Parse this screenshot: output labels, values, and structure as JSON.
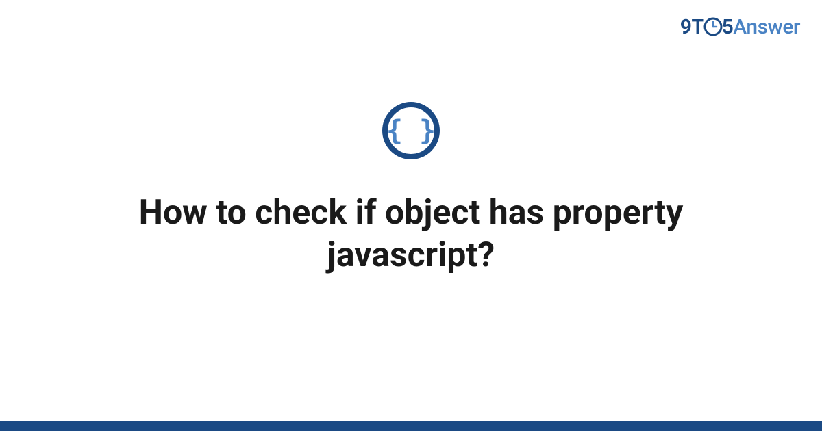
{
  "logo": {
    "part1": "9T",
    "part2": "5",
    "part3": "Answer"
  },
  "title": "How to check if object has property javascript?",
  "colors": {
    "brand_dark": "#1b4a84",
    "brand_light": "#4a83c4",
    "text": "#1a1a1a"
  },
  "category_icon": "curly-braces-icon"
}
